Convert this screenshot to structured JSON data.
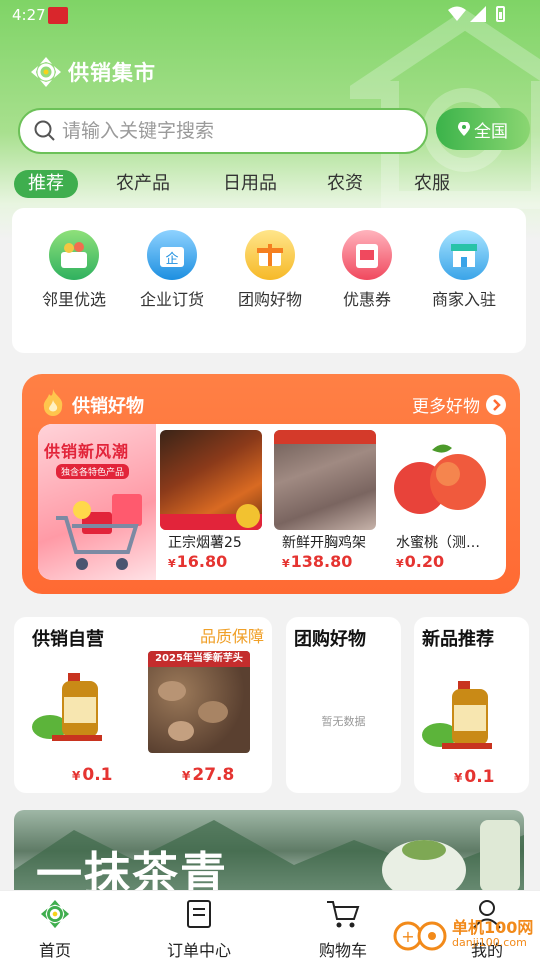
{
  "status_bar": {
    "time": "4:27"
  },
  "app": {
    "name": "供销集市"
  },
  "search": {
    "placeholder": "请输入关键字搜索"
  },
  "region_button": {
    "label": "全国"
  },
  "categories": [
    "推荐",
    "农产品",
    "日用品",
    "农资",
    "农服"
  ],
  "quick_entries": [
    {
      "label": "邻里优选",
      "icon": "basket-icon"
    },
    {
      "label": "企业订货",
      "icon": "enterprise-icon"
    },
    {
      "label": "团购好物",
      "icon": "gift-icon"
    },
    {
      "label": "优惠券",
      "icon": "coupon-icon"
    },
    {
      "label": "商家入驻",
      "icon": "shop-icon"
    }
  ],
  "featured": {
    "title": "供销好物",
    "more_label": "更多好物",
    "banner": {
      "line1": "供销新风潮",
      "line2": "独含各特色产品"
    },
    "products": [
      {
        "name": "正宗烟薯25",
        "currency": "¥",
        "price": "16.80"
      },
      {
        "name": "新鲜开胸鸡架",
        "currency": "¥",
        "price": "138.80"
      },
      {
        "name": "水蜜桃（测试用...",
        "currency": "¥",
        "price": "0.20"
      }
    ]
  },
  "self_operated": {
    "title": "供销自营",
    "tag": "品质保障",
    "items": [
      {
        "currency": "¥",
        "price": "0.1"
      },
      {
        "image_caption": "2025年当季新芋头",
        "currency": "¥",
        "price": "27.8"
      }
    ]
  },
  "group_buy": {
    "title": "团购好物",
    "empty_text": "暂无数据"
  },
  "new_products": {
    "title": "新品推荐",
    "items": [
      {
        "currency": "¥",
        "price": "0.1"
      }
    ]
  },
  "promo_banner": {
    "text": "一抹茶青"
  },
  "tabbar": [
    {
      "label": "首页",
      "icon": "home-icon"
    },
    {
      "label": "订单中心",
      "icon": "order-icon"
    },
    {
      "label": "购物车",
      "icon": "cart-icon"
    },
    {
      "label": "我的",
      "icon": "user-icon"
    }
  ],
  "watermark": {
    "text": "单机100网",
    "domain": "danji100.com"
  },
  "colors": {
    "brand_green": "#3fae4e",
    "orange": "#ff6a33",
    "price_red": "#e53431",
    "tag_orange": "#f0a028"
  }
}
